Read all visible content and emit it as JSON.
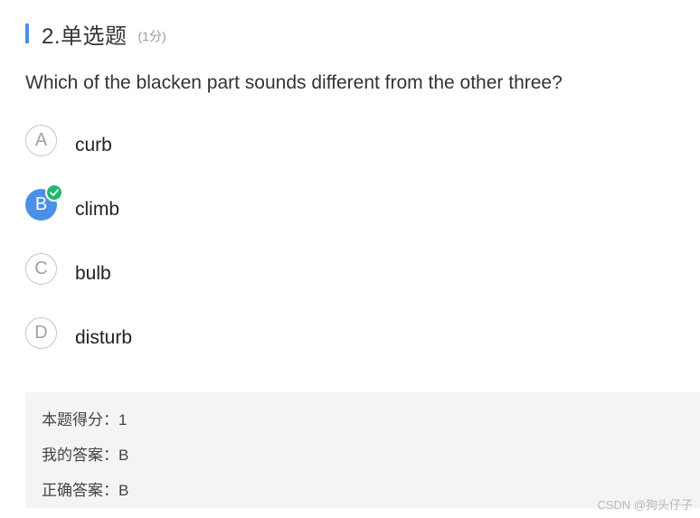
{
  "question": {
    "number_title": "2.单选题",
    "score_label": "(1分)",
    "stem": "Which of the blacken part sounds different from the other three?"
  },
  "options": [
    {
      "letter": "A",
      "text": "curb",
      "selected": false
    },
    {
      "letter": "B",
      "text": "climb",
      "selected": true
    },
    {
      "letter": "C",
      "text": "bulb",
      "selected": false
    },
    {
      "letter": "D",
      "text": "disturb",
      "selected": false
    }
  ],
  "result": {
    "score_line": "本题得分：1",
    "my_answer_line": "我的答案：B",
    "correct_answer_line": "正确答案：B"
  },
  "watermark": "CSDN @狗头仔子",
  "colors": {
    "accent": "#4c8fe8",
    "correct": "#1fb86c",
    "result_bg": "#f4f4f4"
  },
  "icons": {
    "correct_mark": "check-icon"
  }
}
